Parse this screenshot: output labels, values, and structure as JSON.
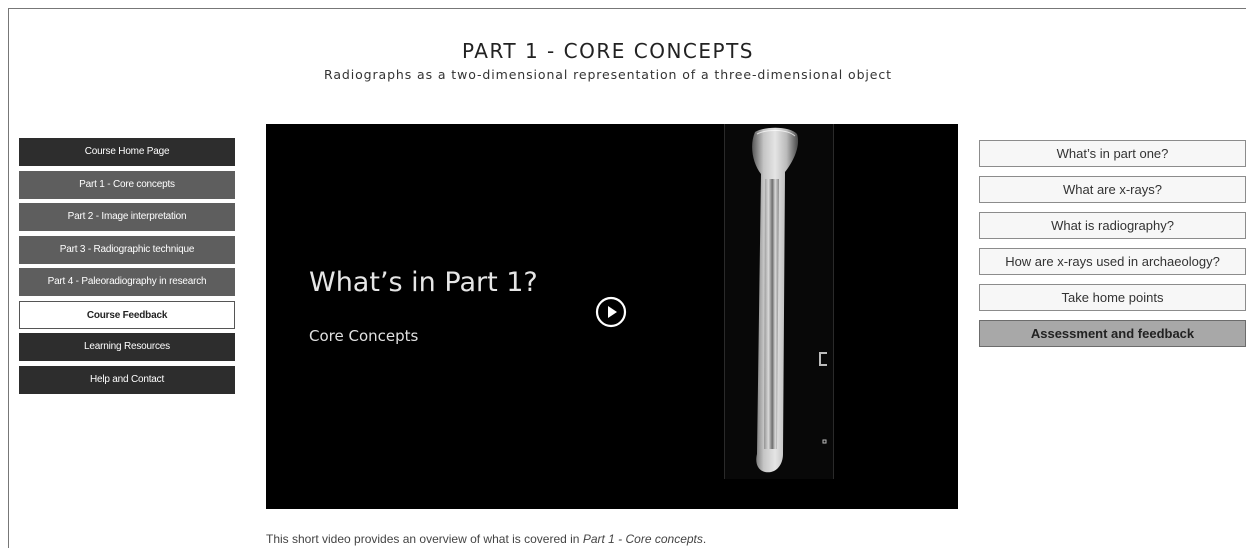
{
  "header": {
    "title": "PART 1 - CORE CONCEPTS",
    "subtitle": "Radiographs as a two-dimensional representation of a three-dimensional object"
  },
  "left_nav": {
    "items": [
      {
        "label": "Course Home Page",
        "style": "dark"
      },
      {
        "label": "Part 1 - Core concepts",
        "style": "mid"
      },
      {
        "label": "Part 2 - Image interpretation",
        "style": "mid"
      },
      {
        "label": "Part 3 - Radiographic technique",
        "style": "mid"
      },
      {
        "label": "Part 4 - Paleoradiography in research",
        "style": "mid"
      },
      {
        "label": "Course Feedback",
        "style": "light"
      },
      {
        "label": "Learning Resources",
        "style": "dark"
      },
      {
        "label": "Help and Contact",
        "style": "dark"
      }
    ]
  },
  "video": {
    "title": "What’s in Part 1?",
    "subtitle": "Core Concepts",
    "play_icon": "play-circle-icon"
  },
  "right_nav": {
    "items": [
      {
        "label": "What’s in part one?",
        "active": false
      },
      {
        "label": "What are x-rays?",
        "active": false
      },
      {
        "label": "What is radiography?",
        "active": false
      },
      {
        "label": "How are x-rays used in archaeology?",
        "active": false
      },
      {
        "label": "Take home points",
        "active": false
      },
      {
        "label": "Assessment and feedback",
        "active": true
      }
    ]
  },
  "caption": {
    "prefix": "This short video provides an overview of what is covered in ",
    "emphasis": "Part 1 - Core concepts",
    "suffix": "."
  },
  "colors": {
    "nav_dark": "#2d2d2d",
    "nav_mid": "#5e5e5e",
    "active_topic": "#a8a8a8",
    "video_bg": "#000000"
  }
}
